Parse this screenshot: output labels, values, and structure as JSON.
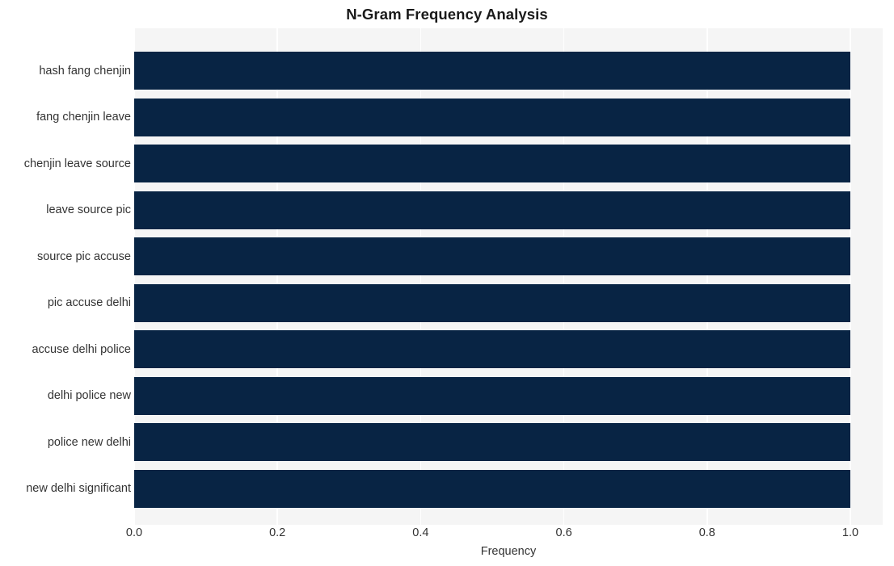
{
  "chart_data": {
    "type": "bar",
    "orientation": "horizontal",
    "title": "N-Gram Frequency Analysis",
    "xlabel": "Frequency",
    "ylabel": "",
    "xlim": [
      0.0,
      1.0
    ],
    "xticks": [
      "0.0",
      "0.2",
      "0.4",
      "0.6",
      "0.8",
      "1.0"
    ],
    "xtick_values": [
      0.0,
      0.2,
      0.4,
      0.6,
      0.8,
      1.0
    ],
    "grid": "vertical",
    "legend": "none",
    "bar_color": "#082444",
    "plot_background": "#f5f5f5",
    "figure_background": "#ffffff",
    "gridline_color": "#ffffff",
    "categories": [
      "hash fang chenjin",
      "fang chenjin leave",
      "chenjin leave source",
      "leave source pic",
      "source pic accuse",
      "pic accuse delhi",
      "accuse delhi police",
      "delhi police new",
      "police new delhi",
      "new delhi significant"
    ],
    "values": [
      1.0,
      1.0,
      1.0,
      1.0,
      1.0,
      1.0,
      1.0,
      1.0,
      1.0,
      1.0
    ]
  }
}
